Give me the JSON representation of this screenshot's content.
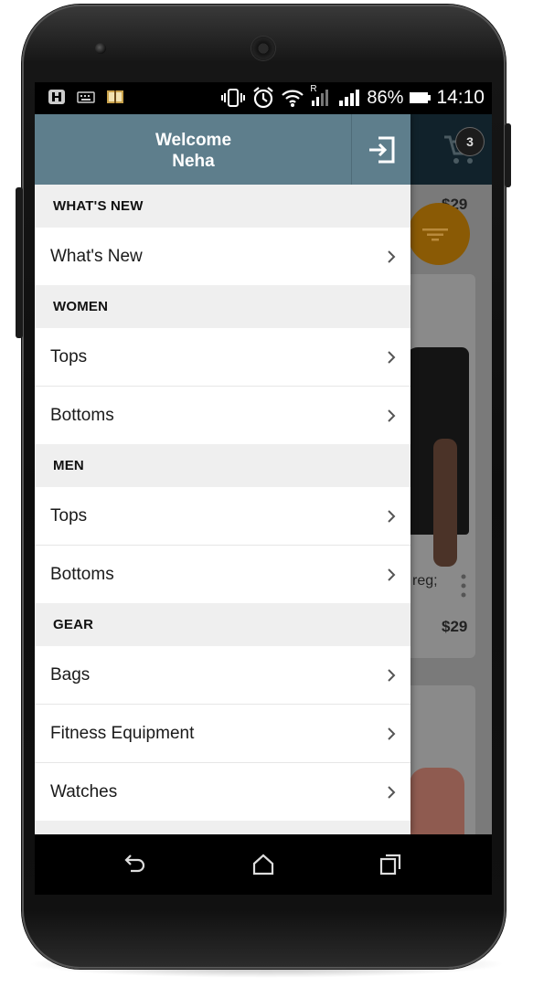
{
  "statusbar": {
    "battery": "86%",
    "time": "14:10",
    "signal_roaming": "R"
  },
  "cart": {
    "count": "3"
  },
  "background": {
    "price_top": "$29",
    "product_text": "reg;",
    "price_bottom": "$29"
  },
  "drawer": {
    "welcome_line1": "Welcome",
    "welcome_line2": "Neha",
    "sections": [
      {
        "title": "WHAT'S NEW",
        "items": [
          "What's New"
        ]
      },
      {
        "title": "WOMEN",
        "items": [
          "Tops",
          "Bottoms"
        ]
      },
      {
        "title": "MEN",
        "items": [
          "Tops",
          "Bottoms"
        ]
      },
      {
        "title": "GEAR",
        "items": [
          "Bags",
          "Fitness Equipment",
          "Watches"
        ]
      }
    ]
  },
  "colors": {
    "drawer_header": "#5e7e8c",
    "section_bg": "#efefef",
    "fab": "#8a5a05",
    "appbar": "#11222b"
  },
  "icons": [
    "logout-icon",
    "cart-icon",
    "filter-icon",
    "chevron-right-icon",
    "back-icon",
    "home-icon",
    "recents-icon"
  ]
}
